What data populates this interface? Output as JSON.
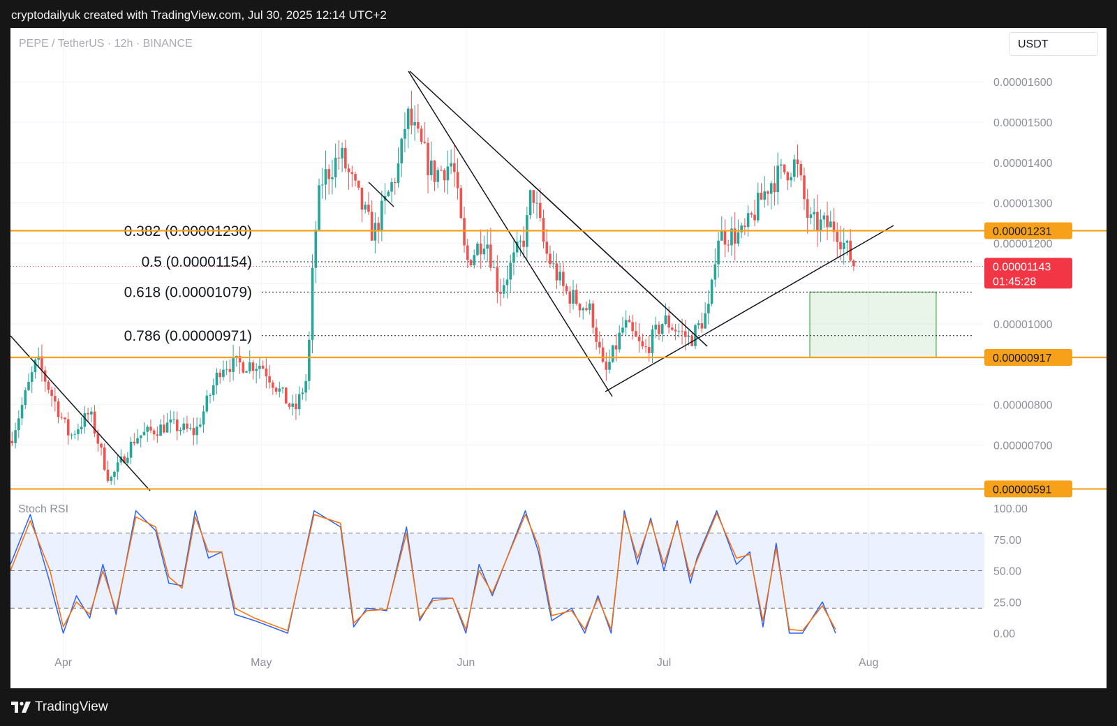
{
  "header": {
    "caption": "cryptodailyuk created with TradingView.com, Jul 30, 2025 12:14 UTC+2"
  },
  "chart": {
    "symbol_line": "PEPE / TetherUS · 12h · BINANCE",
    "currency": "USDT",
    "indicator_label": "Stoch RSI",
    "footer_brand": "TradingView"
  },
  "colors": {
    "up": "#26a69a",
    "down": "#ef5350",
    "level": "#f7a11a",
    "price_tag": "#f23645",
    "k_line": "#2962ff",
    "d_line": "#ff6d00",
    "zone": "#4caf50"
  },
  "chart_data": [
    {
      "type": "candlestick",
      "title": "PEPE / TetherUS · 12h · BINANCE",
      "x_ticks": [
        "Apr",
        "May",
        "Jun",
        "Jul",
        "Aug"
      ],
      "y_ticks": [
        "0.00000700",
        "0.00000800",
        "0.00001000",
        "0.00001200",
        "0.00001300",
        "0.00001400",
        "0.00001500",
        "0.00001600"
      ],
      "ylim": [
        5.9e-06,
        1.65e-05
      ],
      "grid": true,
      "close_path": [
        [
          "Mar 24",
          7.1e-06
        ],
        [
          "Mar 28",
          9.1e-06
        ],
        [
          "Apr 2",
          7.2e-06
        ],
        [
          "Apr 5",
          7.8e-06
        ],
        [
          "Apr 8",
          6.1e-06
        ],
        [
          "Apr 12",
          7.2e-06
        ],
        [
          "Apr 17",
          7.5e-06
        ],
        [
          "Apr 21",
          7.3e-06
        ],
        [
          "Apr 25",
          9e-06
        ],
        [
          "May 1",
          9e-06
        ],
        [
          "May 6",
          7.8e-06
        ],
        [
          "May 8",
          8.7e-06
        ],
        [
          "May 9",
          1.2e-05
        ],
        [
          "May 10",
          1.35e-05
        ],
        [
          "May 13",
          1.42e-05
        ],
        [
          "May 18",
          1.22e-05
        ],
        [
          "May 22",
          1.4e-05
        ],
        [
          "May 23",
          1.52e-05
        ],
        [
          "May 27",
          1.37e-05
        ],
        [
          "May 30",
          1.4e-05
        ],
        [
          "Jun 1",
          1.15e-05
        ],
        [
          "Jun 4",
          1.22e-05
        ],
        [
          "Jun 6",
          1.08e-05
        ],
        [
          "Jun 10",
          1.22e-05
        ],
        [
          "Jun 11",
          1.34e-05
        ],
        [
          "Jun 13",
          1.18e-05
        ],
        [
          "Jun 16",
          1.08e-05
        ],
        [
          "Jun 20",
          1.03e-05
        ],
        [
          "Jun 22",
          8.7e-06
        ],
        [
          "Jun 25",
          1e-05
        ],
        [
          "Jun 28",
          9.3e-06
        ],
        [
          "Jul 1",
          1.01e-05
        ],
        [
          "Jul 5",
          9.6e-06
        ],
        [
          "Jul 8",
          1.04e-05
        ],
        [
          "Jul 9",
          1.22e-05
        ],
        [
          "Jul 13",
          1.22e-05
        ],
        [
          "Jul 17",
          1.35e-05
        ],
        [
          "Jul 21",
          1.4e-05
        ],
        [
          "Jul 23",
          1.25e-05
        ],
        [
          "Jul 27",
          1.24e-05
        ],
        [
          "Jul 30",
          1.14e-05
        ]
      ],
      "fib_levels": [
        {
          "label": "0.382 (0.00001230)",
          "value": 1.23e-05
        },
        {
          "label": "0.5 (0.00001154)",
          "value": 1.154e-05
        },
        {
          "label": "0.618 (0.00001079)",
          "value": 1.079e-05
        },
        {
          "label": "0.786 (0.00000971)",
          "value": 9.71e-06
        }
      ],
      "horizontal_levels": [
        {
          "label": "0.00001231",
          "value": 1.231e-05
        },
        {
          "label": "0.00000917",
          "value": 9.17e-06
        },
        {
          "label": "0.00000591",
          "value": 5.91e-06
        }
      ],
      "last_price": {
        "label": "0.00001143",
        "value": 1.143e-05,
        "countdown": "01:45:28"
      },
      "target_zone": {
        "top": 1.079e-05,
        "bottom": 9.17e-06,
        "from": "Jul 23",
        "to": "Aug 1"
      }
    },
    {
      "type": "line",
      "title": "Stoch RSI",
      "y_ticks": [
        "100.00",
        "75.00",
        "50.00",
        "25.00",
        "0.00"
      ],
      "ylim": [
        0,
        100
      ],
      "bands": [
        80,
        50,
        20
      ],
      "series": [
        {
          "key": "k",
          "points": [
            [
              "Mar 24",
              55
            ],
            [
              "Mar 27",
              95
            ],
            [
              "Mar 30",
              40
            ],
            [
              "Apr 1",
              0
            ],
            [
              "Apr 3",
              30
            ],
            [
              "Apr 5",
              12
            ],
            [
              "Apr 7",
              55
            ],
            [
              "Apr 9",
              15
            ],
            [
              "Apr 12",
              98
            ],
            [
              "Apr 15",
              82
            ],
            [
              "Apr 17",
              40
            ],
            [
              "Apr 19",
              38
            ],
            [
              "Apr 21",
              98
            ],
            [
              "Apr 23",
              60
            ],
            [
              "Apr 25",
              65
            ],
            [
              "Apr 27",
              15
            ],
            [
              "Apr 30",
              10
            ],
            [
              "May 5",
              0
            ],
            [
              "May 9",
              98
            ],
            [
              "May 13",
              85
            ],
            [
              "May 15",
              5
            ],
            [
              "May 17",
              20
            ],
            [
              "May 20",
              18
            ],
            [
              "May 23",
              85
            ],
            [
              "May 25",
              10
            ],
            [
              "May 27",
              28
            ],
            [
              "May 30",
              28
            ],
            [
              "Jun 1",
              0
            ],
            [
              "Jun 3",
              55
            ],
            [
              "Jun 5",
              30
            ],
            [
              "Jun 10",
              98
            ],
            [
              "Jun 12",
              65
            ],
            [
              "Jun 14",
              10
            ],
            [
              "Jun 17",
              20
            ],
            [
              "Jun 19",
              0
            ],
            [
              "Jun 21",
              30
            ],
            [
              "Jun 23",
              0
            ],
            [
              "Jun 25",
              98
            ],
            [
              "Jun 27",
              55
            ],
            [
              "Jun 29",
              92
            ],
            [
              "Jul 1",
              50
            ],
            [
              "Jul 3",
              90
            ],
            [
              "Jul 5",
              40
            ],
            [
              "Jul 6",
              60
            ],
            [
              "Jul 9",
              98
            ],
            [
              "Jul 12",
              55
            ],
            [
              "Jul 14",
              65
            ],
            [
              "Jul 16",
              5
            ],
            [
              "Jul 18",
              72
            ],
            [
              "Jul 20",
              0
            ],
            [
              "Jul 22",
              0
            ],
            [
              "Jul 25",
              25
            ],
            [
              "Jul 27",
              0
            ]
          ]
        },
        {
          "key": "d",
          "points": [
            [
              "Mar 24",
              50
            ],
            [
              "Mar 27",
              90
            ],
            [
              "Mar 30",
              50
            ],
            [
              "Apr 1",
              5
            ],
            [
              "Apr 3",
              25
            ],
            [
              "Apr 5",
              15
            ],
            [
              "Apr 7",
              50
            ],
            [
              "Apr 9",
              18
            ],
            [
              "Apr 12",
              93
            ],
            [
              "Apr 15",
              85
            ],
            [
              "Apr 17",
              45
            ],
            [
              "Apr 19",
              36
            ],
            [
              "Apr 21",
              93
            ],
            [
              "Apr 23",
              65
            ],
            [
              "Apr 25",
              65
            ],
            [
              "Apr 27",
              20
            ],
            [
              "Apr 30",
              12
            ],
            [
              "May 5",
              2
            ],
            [
              "May 9",
              95
            ],
            [
              "May 13",
              88
            ],
            [
              "May 15",
              8
            ],
            [
              "May 17",
              18
            ],
            [
              "May 20",
              19
            ],
            [
              "May 23",
              80
            ],
            [
              "May 25",
              12
            ],
            [
              "May 27",
              26
            ],
            [
              "May 30",
              28
            ],
            [
              "Jun 1",
              3
            ],
            [
              "Jun 3",
              50
            ],
            [
              "Jun 5",
              32
            ],
            [
              "Jun 10",
              95
            ],
            [
              "Jun 12",
              70
            ],
            [
              "Jun 14",
              14
            ],
            [
              "Jun 17",
              18
            ],
            [
              "Jun 19",
              3
            ],
            [
              "Jun 21",
              28
            ],
            [
              "Jun 23",
              3
            ],
            [
              "Jun 25",
              95
            ],
            [
              "Jun 27",
              60
            ],
            [
              "Jun 29",
              90
            ],
            [
              "Jul 1",
              55
            ],
            [
              "Jul 3",
              88
            ],
            [
              "Jul 5",
              45
            ],
            [
              "Jul 6",
              58
            ],
            [
              "Jul 9",
              96
            ],
            [
              "Jul 12",
              60
            ],
            [
              "Jul 14",
              63
            ],
            [
              "Jul 16",
              10
            ],
            [
              "Jul 18",
              68
            ],
            [
              "Jul 20",
              3
            ],
            [
              "Jul 22",
              2
            ],
            [
              "Jul 25",
              22
            ],
            [
              "Jul 27",
              3
            ]
          ]
        }
      ]
    }
  ]
}
